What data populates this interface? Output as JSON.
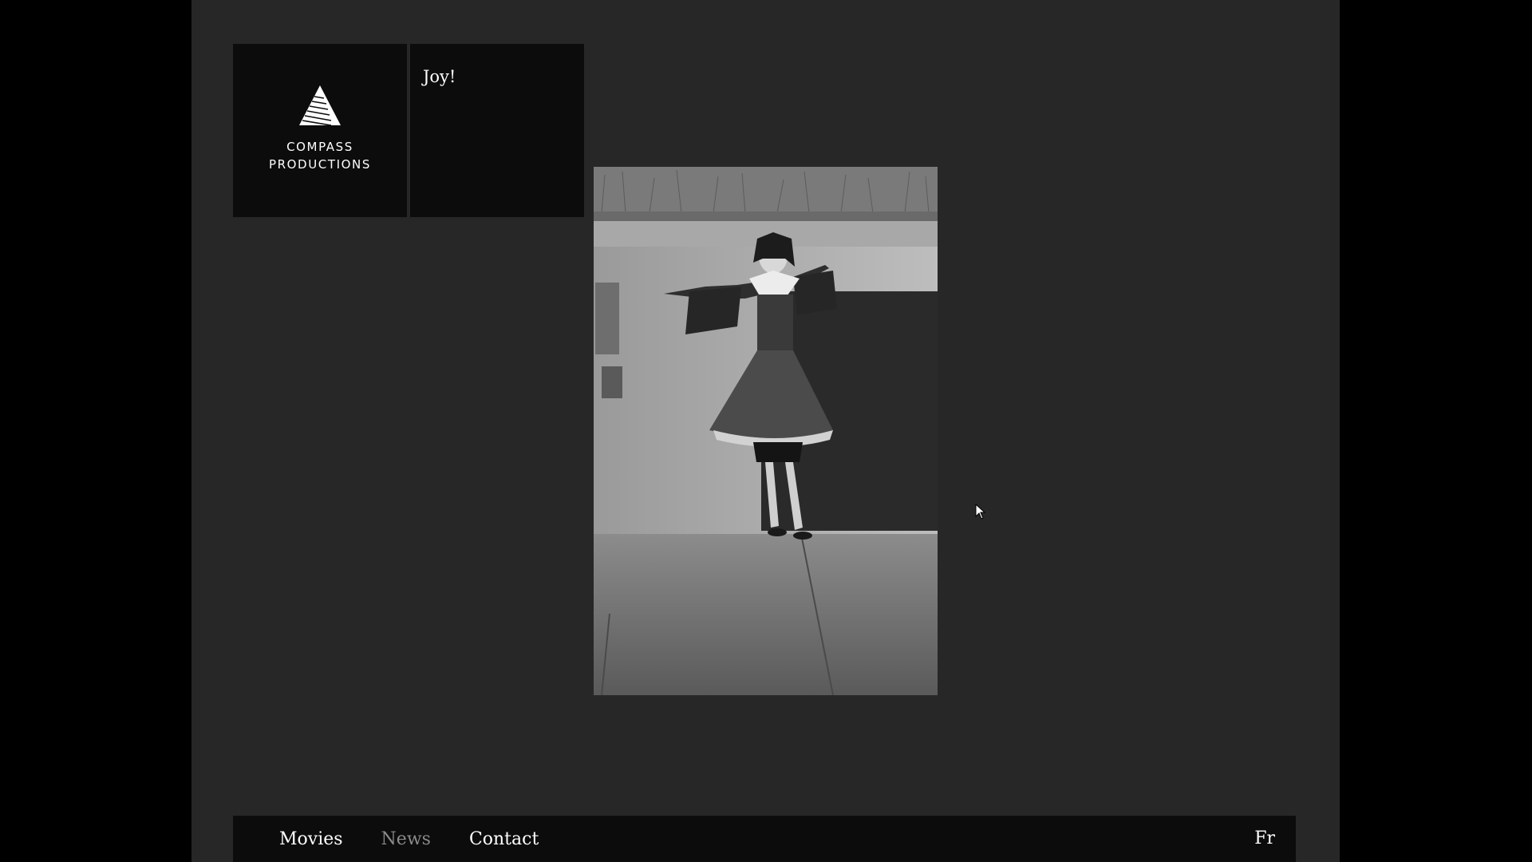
{
  "logo": {
    "line1": "COMPASS",
    "line2": "PRODUCTIONS"
  },
  "title_tile": {
    "title": "Joy!"
  },
  "photo": {
    "description_icon": "photo-nun-twirling"
  },
  "nav": {
    "items": [
      {
        "label": "Movies",
        "active": false
      },
      {
        "label": "News",
        "active": true
      },
      {
        "label": "Contact",
        "active": false
      }
    ],
    "language": "Fr"
  },
  "colors": {
    "page_bg": "#272727",
    "outer_bg": "#000000",
    "tile_bg": "#0c0c0c",
    "nav_dim": "#8a8a8a",
    "text": "#ffffff"
  }
}
